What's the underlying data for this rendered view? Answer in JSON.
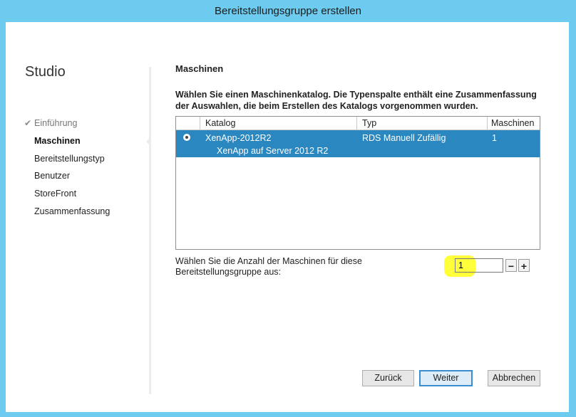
{
  "window": {
    "title": "Bereitstellungsgruppe erstellen"
  },
  "sidebar": {
    "app_name": "Studio",
    "steps": [
      {
        "label": "Einführung",
        "state": "done"
      },
      {
        "label": "Maschinen",
        "state": "active"
      },
      {
        "label": "Bereitstellungstyp",
        "state": "pending"
      },
      {
        "label": "Benutzer",
        "state": "pending"
      },
      {
        "label": "StoreFront",
        "state": "pending"
      },
      {
        "label": "Zusammenfassung",
        "state": "pending"
      }
    ],
    "check_icon": "✔"
  },
  "main": {
    "heading": "Maschinen",
    "instructions": "Wählen Sie einen Maschinenkatalog. Die Typenspalte enthält eine Zusammenfassung der Auswahlen, die beim Erstellen des Katalogs vorgenommen wurden.",
    "table": {
      "columns": [
        "Katalog",
        "Typ",
        "Maschinen"
      ],
      "rows": [
        {
          "selected": true,
          "catalog": "XenApp-2012R2",
          "description": "XenApp auf Server 2012 R2",
          "type": "RDS Manuell Zufällig",
          "machines": "1"
        }
      ]
    },
    "count_label": "Wählen Sie die Anzahl der Maschinen für diese Bereitstellungsgruppe aus:",
    "count_value": "1",
    "decrement_symbol": "−",
    "increment_symbol": "+"
  },
  "footer": {
    "back_label": "Zurück",
    "next_label": "Weiter",
    "cancel_label": "Abbrechen"
  },
  "colors": {
    "accent": "#6ccbee",
    "selection": "#2a87c0",
    "highlight": "#ffff3a"
  }
}
